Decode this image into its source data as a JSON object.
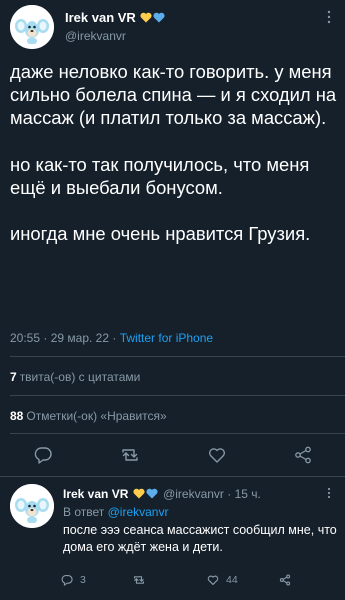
{
  "tweet": {
    "display_name": "Irek van VR",
    "handle": "@irekvanvr",
    "text": "даже неловко как-то говорить. у меня сильно болела спина — и я сходил на массаж (и платил только за массаж).\n\nно как-то так получилось, что меня ещё и выебали бонусом.\n\nиногда мне очень нравится Грузия.",
    "time": "20:55",
    "separator": "·",
    "date": "29 мар. 22",
    "source": "Twitter for iPhone"
  },
  "stats": {
    "quotes_count": "7",
    "quotes_label": "твита(-ов) с цитатами",
    "likes_count": "88",
    "likes_label": "Отметки(-ок) «Нравится»"
  },
  "actions": {
    "icons": [
      "reply-icon",
      "retweet-icon",
      "like-icon",
      "share-icon"
    ]
  },
  "reply": {
    "display_name": "Irek van VR",
    "handle_time": "@irekvanvr · 15 ч.",
    "replying_prefix": "В ответ",
    "replying_to": "@irekvanvr",
    "text": "после эээ сеанса массажист сообщил мне, что дома его ждёт жена и дети.",
    "reply_count": "3",
    "retweet_count": "",
    "like_count": "44"
  },
  "colors": {
    "background": "#15202b",
    "text": "#ffffff",
    "muted": "#8899a6",
    "link": "#1da1f2",
    "divider": "#38444d",
    "heart_yellow": "#ffcc4d",
    "heart_blue": "#5dadec"
  }
}
